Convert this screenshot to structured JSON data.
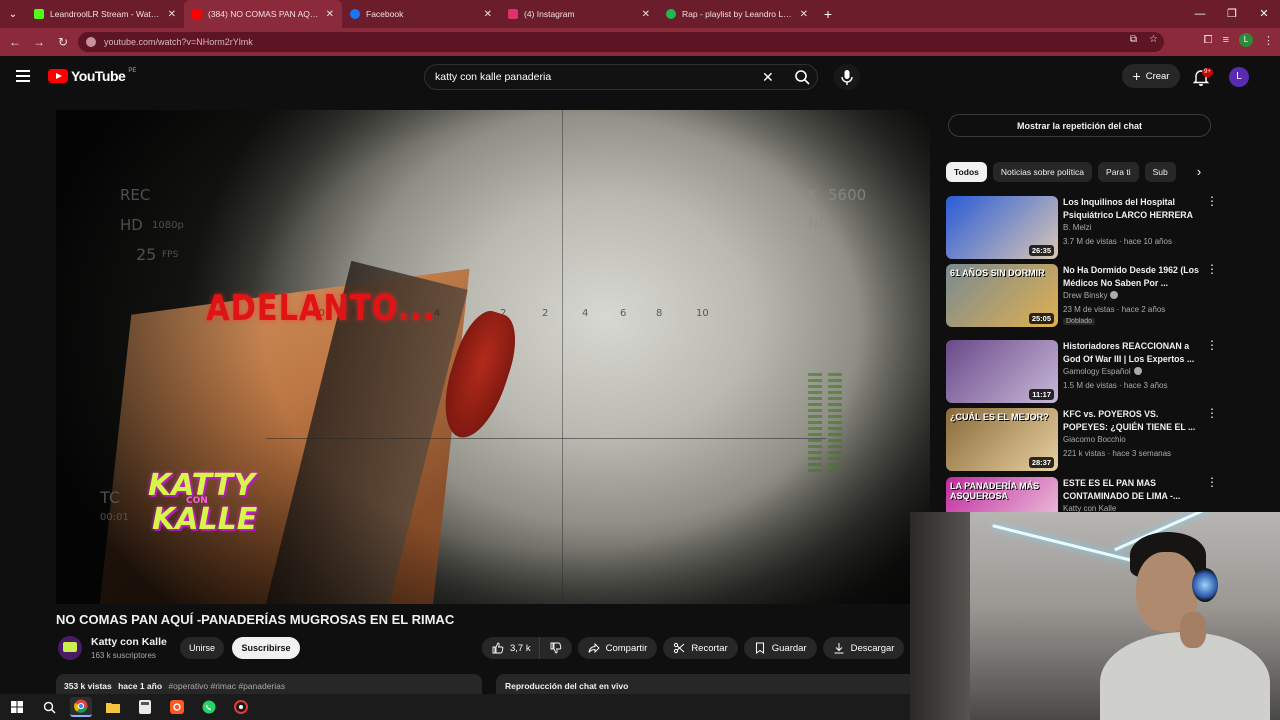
{
  "browser": {
    "tabs": [
      {
        "title": "LeandroolLR Stream - Watch Liv",
        "favicon_color": "#53fc18"
      },
      {
        "title": "(384) NO COMAS PAN AQUÍ -P",
        "favicon_color": "#ff0000"
      },
      {
        "title": "Facebook",
        "favicon_color": "#1877f2"
      },
      {
        "title": "(4) Instagram",
        "favicon_color": "#e1306c"
      },
      {
        "title": "Rap - playlist by Leandro LR | S",
        "favicon_color": "#1db954"
      }
    ],
    "url": "youtube.com/watch?v=NHorm2rYlmk",
    "profile_initial": "L"
  },
  "youtube": {
    "logo_text": "YouTube",
    "country": "PE",
    "search_value": "katty con kalle panaderia",
    "create_label": "Crear",
    "notifications_badge": "9+",
    "avatar_initial": "L"
  },
  "player": {
    "overlay_text": "ADELANTO...",
    "hud": {
      "rec": "REC",
      "hd": "HD",
      "res": "1080p",
      "fps_value": "25",
      "fps_label": "FPS",
      "tc": "TC",
      "tc_time": "00:01",
      "iso": "5600",
      "nd": "ND"
    },
    "scale_ticks": [
      "10",
      "8",
      "6",
      "4",
      "2",
      "2",
      "4",
      "6",
      "8",
      "10"
    ],
    "logo_line1": "KATTY",
    "logo_line2": "CON",
    "logo_line3": "KALLE"
  },
  "video": {
    "title": "NO COMAS PAN AQUÍ -PANADERÍAS MUGROSAS EN EL RIMAC",
    "channel": "Katty con Kalle",
    "subscribers": "163 k suscriptores",
    "join_label": "Unirse",
    "subscribe_label": "Suscribirse",
    "likes": "3,7 k",
    "share_label": "Compartir",
    "clip_label": "Recortar",
    "save_label": "Guardar",
    "download_label": "Descargar",
    "views": "353 k vistas",
    "age": "hace 1 año",
    "tags": "#operativo #rimac #panaderias",
    "chat_replay_footer": "Reproducción del chat en vivo"
  },
  "sidebar": {
    "chat_replay_button": "Mostrar la repetición del chat",
    "chips": [
      "Todos",
      "Noticias sobre política",
      "Para ti",
      "Sub"
    ],
    "recommendations": [
      {
        "title": "Los Inquilinos del Hospital Psiquiátrico LARCO HERRERA ...",
        "channel": "B. Melzi",
        "meta": "3.7 M de vistas · hace 10 años",
        "duration": "26:35",
        "badge": "",
        "verified": false,
        "thumb_a": "#2a5bd8",
        "thumb_b": "#d9c7b4"
      },
      {
        "title": "No Ha Dormido Desde 1962 (Los Médicos No Saben Por ...",
        "channel": "Drew Binsky",
        "meta": "23 M de vistas · hace 2 años",
        "duration": "25:05",
        "badge": "Doblado",
        "verified": true,
        "thumb_a": "#7a8a92",
        "thumb_b": "#e0b050",
        "thumb_text": "61 AÑOS SIN DORMIR"
      },
      {
        "title": "Historiadores REACCIONAN a God Of War III | Los Expertos ...",
        "channel": "Gamology Español",
        "meta": "1.5 M de vistas · hace 3 años",
        "duration": "11:17",
        "badge": "",
        "verified": true,
        "thumb_a": "#6a4a8a",
        "thumb_b": "#c8b8d8"
      },
      {
        "title": "KFC vs. POYEROS VS. POPEYES: ¿QUIÉN TIENE EL ...",
        "channel": "Giacomo Bocchio",
        "meta": "221 k vistas · hace 3 semanas",
        "duration": "28:37",
        "badge": "",
        "verified": false,
        "thumb_a": "#8a6a3a",
        "thumb_b": "#e8d0a0",
        "thumb_text": "¿CUÁL ES EL MEJOR?"
      },
      {
        "title": "ESTE ES EL PAN MAS CONTAMINADO DE LIMA -...",
        "channel": "Katty con Kalle",
        "meta": "",
        "duration": "",
        "badge": "",
        "verified": false,
        "thumb_a": "#c02aa0",
        "thumb_b": "#f0d0e0",
        "thumb_text": "LA PANADERÍA MÁS ASQUEROSA"
      }
    ]
  }
}
